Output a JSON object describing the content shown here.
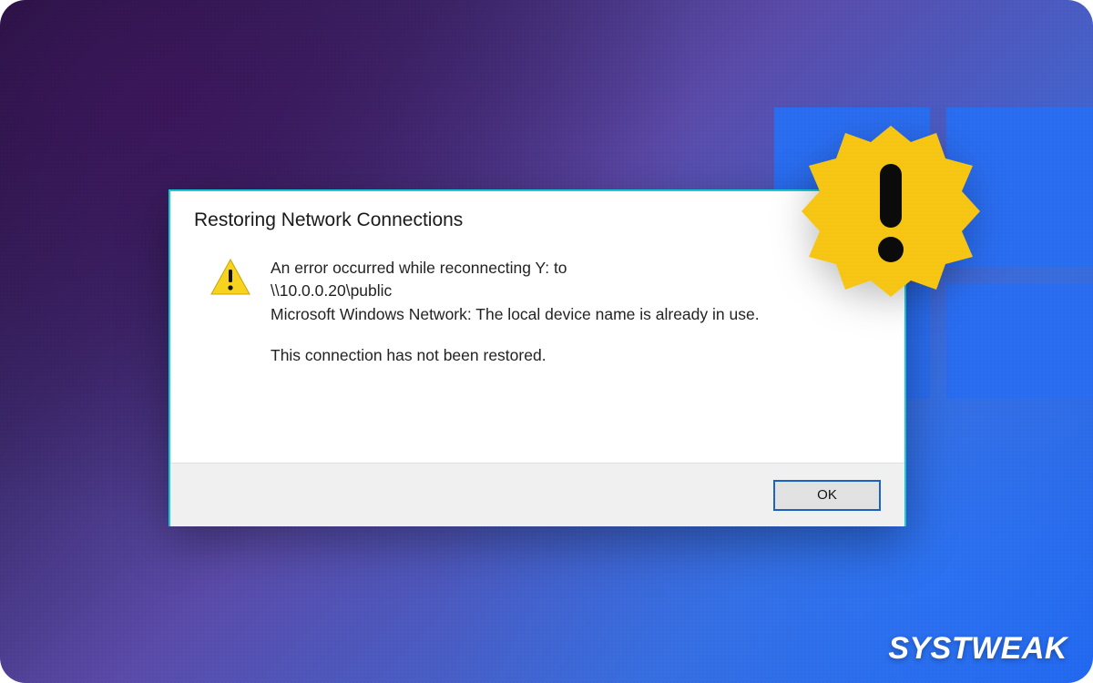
{
  "dialog": {
    "title": "Restoring Network Connections",
    "message_line1": "An error occurred while reconnecting Y: to",
    "message_line2": "\\\\10.0.0.20\\public",
    "message_line3": "Microsoft Windows Network: The local device name is already in use.",
    "message_line4": "This connection has not been restored.",
    "ok_label": "OK"
  },
  "badge": {
    "glyph": "!"
  },
  "watermark": "SYSTWEAK"
}
